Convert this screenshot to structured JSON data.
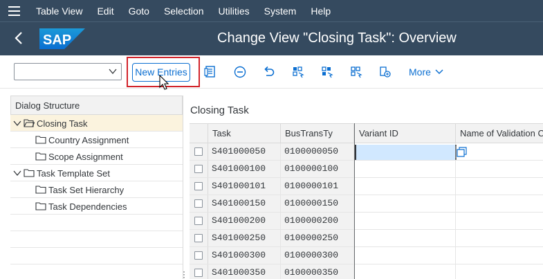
{
  "menu": {
    "items": [
      "Table View",
      "Edit",
      "Goto",
      "Selection",
      "Utilities",
      "System",
      "Help"
    ]
  },
  "header": {
    "logo_text": "SAP",
    "title": "Change View \"Closing Task\": Overview"
  },
  "toolbar": {
    "dropdown_value": "",
    "new_entries_label": "New Entries",
    "more_label": "More",
    "icons": [
      "details-icon",
      "delete-icon",
      "undo-icon",
      "select-all-icon",
      "select-block-icon",
      "deselect-all-icon",
      "print-field-list-icon"
    ]
  },
  "dialog": {
    "title": "Dialog Structure",
    "nodes": [
      {
        "label": "Closing Task",
        "level": 0,
        "expanded": true,
        "selected": true
      },
      {
        "label": "Country Assignment",
        "level": 1
      },
      {
        "label": "Scope Assignment",
        "level": 1
      },
      {
        "label": "Task Template Set",
        "level": 0,
        "expanded": true
      },
      {
        "label": "Task Set Hierarchy",
        "level": 1
      },
      {
        "label": "Task Dependencies",
        "level": 1
      }
    ]
  },
  "table": {
    "title": "Closing Task",
    "columns": [
      "Task",
      "BusTransTy",
      "Variant ID",
      "Name of Validation C"
    ],
    "rows": [
      {
        "task": "S401000050",
        "bustransty": "0100000050",
        "variant_id": "",
        "name": ""
      },
      {
        "task": "S401000100",
        "bustransty": "0100000100",
        "variant_id": "",
        "name": ""
      },
      {
        "task": "S401000101",
        "bustransty": "0100000101",
        "variant_id": "",
        "name": ""
      },
      {
        "task": "S401000150",
        "bustransty": "0100000150",
        "variant_id": "",
        "name": ""
      },
      {
        "task": "S401000200",
        "bustransty": "0100000200",
        "variant_id": "",
        "name": ""
      },
      {
        "task": "S401000250",
        "bustransty": "0100000250",
        "variant_id": "",
        "name": ""
      },
      {
        "task": "S401000300",
        "bustransty": "0100000300",
        "variant_id": "",
        "name": ""
      },
      {
        "task": "S401000350",
        "bustransty": "0100000350",
        "variant_id": "",
        "name": ""
      }
    ]
  },
  "colors": {
    "shell": "#354a5f",
    "accent": "#0a6ed1",
    "highlight": "#d2232a",
    "selected_node": "#fbf3de",
    "focus_field": "#d1e8ff"
  }
}
